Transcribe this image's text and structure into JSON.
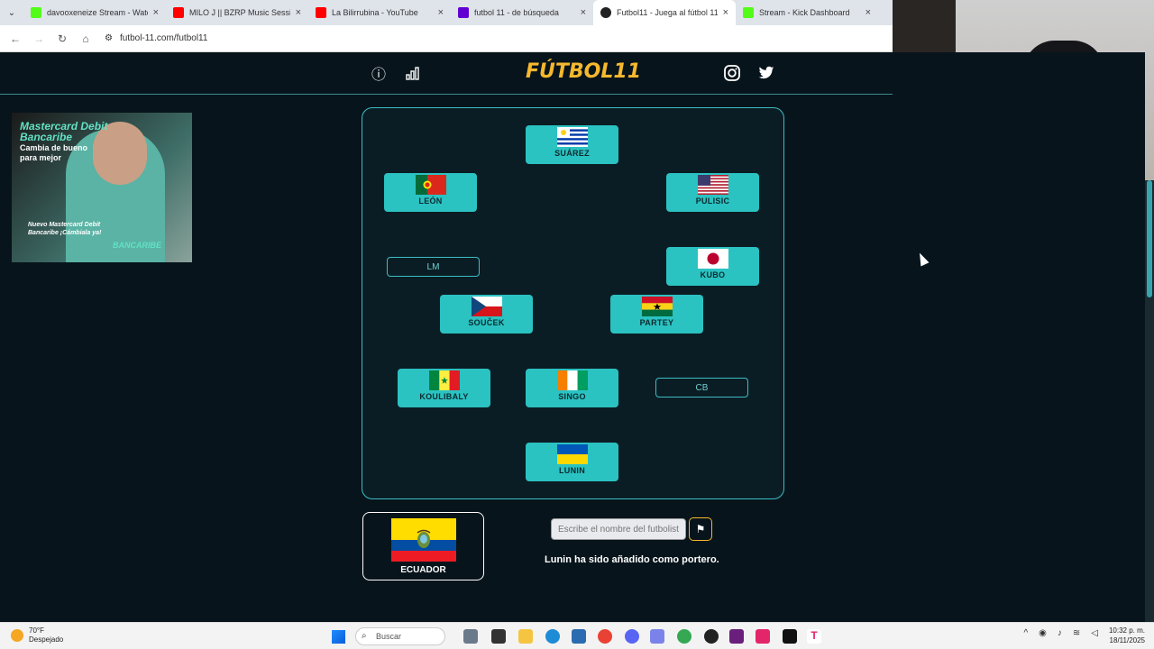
{
  "browser": {
    "tabs": [
      {
        "title": "davooxeneize Stream - Watch L",
        "favicon_color": "#53fc18",
        "active": false
      },
      {
        "title": "MILO J || BZRP Music Sessio",
        "favicon_color": "#ff0000",
        "active": false
      },
      {
        "title": "La Bilirrubina - YouTube",
        "favicon_color": "#ff0000",
        "active": false
      },
      {
        "title": "futbol 11 - de búsqueda",
        "favicon_color": "#6001d2",
        "active": false
      },
      {
        "title": "Futbol11 - Juega al fútbol 11",
        "favicon_color": "#222222",
        "active": true
      },
      {
        "title": "Stream - Kick Dashboard",
        "favicon_color": "#53fc18",
        "active": false
      }
    ],
    "close_glyph": "×",
    "url": "futbol-11.com/futbol11"
  },
  "site": {
    "logo": "FÚTBOL11",
    "info_icon": "ⓘ",
    "stats_icon": "▮",
    "instagram_icon": "◎",
    "twitter_icon": "✦"
  },
  "ad": {
    "headline": "Mastercard Debit Bancaribe",
    "tagline": "Cambia de bueno para mejor",
    "promo": "Nuevo Mastercard Debit Bancaribe ¡Cámbiala ya!",
    "brand": "BANCARIBE"
  },
  "pitch": {
    "players": [
      {
        "name": "SUÁREZ",
        "country": "uruguay"
      },
      {
        "name": "LEÓN",
        "country": "portugal"
      },
      {
        "name": "PULISIC",
        "country": "usa"
      },
      {
        "name": "KUBO",
        "country": "japan"
      },
      {
        "name": "SOUČEK",
        "country": "czechia"
      },
      {
        "name": "PARTEY",
        "country": "ghana"
      },
      {
        "name": "KOULIBALY",
        "country": "senegal"
      },
      {
        "name": "SINGO",
        "country": "ivory-coast"
      },
      {
        "name": "LUNIN",
        "country": "ukraine"
      }
    ],
    "empty_slots": [
      "LM",
      "CB"
    ]
  },
  "game": {
    "country_name": "ECUADOR",
    "input_placeholder": "Escribe el nombre del futbolista",
    "flag_button_icon": "⚑",
    "message": "Lunin ha sido añadido como portero."
  },
  "taskbar": {
    "temperature": "70°F",
    "weather_text": "Despejado",
    "search_label": "Buscar",
    "search_icon": "⌕",
    "time": "10:32 p. m.",
    "date": "18/11/2025"
  },
  "colors": {
    "accent": "#2bc2c2",
    "logo": "#f5b82e",
    "background": "#07141b"
  }
}
